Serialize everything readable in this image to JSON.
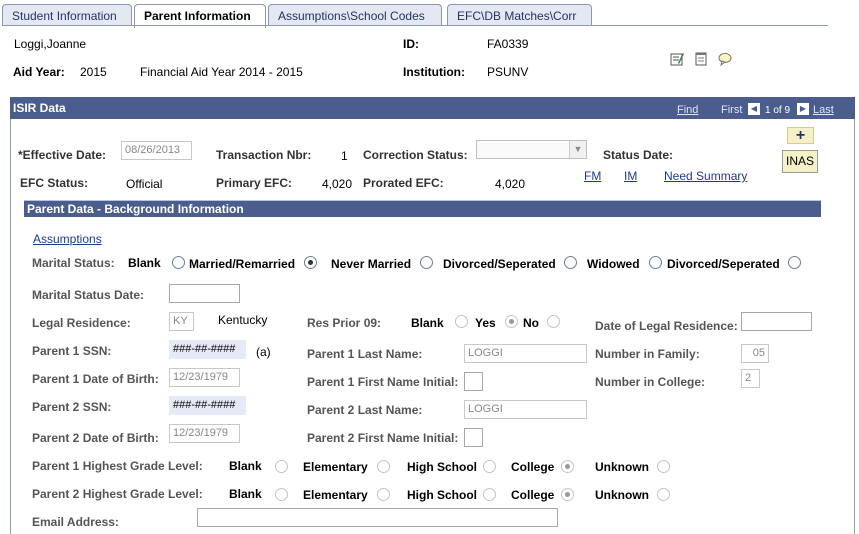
{
  "tabs": [
    {
      "label": "Student Information",
      "active": false
    },
    {
      "label": "Parent Information",
      "active": true
    },
    {
      "label": "Assumptions\\School Codes",
      "active": false
    },
    {
      "label": "EFC\\DB Matches\\Corr",
      "active": false
    }
  ],
  "header": {
    "name": "Loggi,Joanne",
    "id_label": "ID:",
    "id_value": "FA0339",
    "aid_year_label": "Aid Year:",
    "aid_year_value": "2015",
    "aid_year_desc": "Financial Aid Year 2014 - 2015",
    "institution_label": "Institution:",
    "institution_value": "PSUNV"
  },
  "toolbar_icons": [
    "edit-notes-icon",
    "notepad-icon",
    "comment-icon"
  ],
  "isir": {
    "title": "ISIR Data",
    "find": "Find",
    "first": "First",
    "counter": "1 of 9",
    "last": "Last",
    "effective_date_label": "*Effective Date:",
    "effective_date_value": "08/26/2013",
    "transaction_label": "Transaction Nbr:",
    "transaction_value": "1",
    "correction_label": "Correction Status:",
    "correction_value": "",
    "status_date_label": "Status Date:",
    "efc_status_label": "EFC Status:",
    "efc_status_value": "Official",
    "primary_efc_label": "Primary EFC:",
    "primary_efc_value": "4,020",
    "prorated_efc_label": "Prorated EFC:",
    "prorated_efc_value": "4,020",
    "fm_link": "FM",
    "im_link": "IM",
    "need_summary_link": "Need Summary",
    "plus_label": "+",
    "inas_label": "INAS"
  },
  "parent": {
    "section_title": "Parent Data - Background Information",
    "assumptions_link": "Assumptions",
    "marital_status_label": "Marital Status:",
    "marital_options": [
      "Blank",
      "Married/Remarried",
      "Never Married",
      "Divorced/Seperated",
      "Widowed",
      "Divorced/Seperated"
    ],
    "marital_status_date_label": "Marital Status Date:",
    "marital_status_date_value": "",
    "legal_residence_label": "Legal Residence:",
    "legal_residence_code": "KY",
    "legal_residence_name": "Kentucky",
    "res_prior_label": "Res Prior 09:",
    "res_prior_options": [
      "Blank",
      "Yes",
      "No"
    ],
    "date_legal_residence_label": "Date of Legal Residence:",
    "date_legal_residence_value": "",
    "p1_ssn_label": "Parent 1 SSN:",
    "p1_ssn_value": "###-##-####",
    "p1_ssn_suffix": "(a)",
    "p1_last_label": "Parent 1 Last Name:",
    "p1_last_value": "LOGGI",
    "num_family_label": "Number in Family:",
    "num_family_value": "05",
    "p1_dob_label": "Parent 1 Date of Birth:",
    "p1_dob_value": "12/23/1979",
    "p1_first_label": "Parent 1 First Name Initial:",
    "p1_first_value": "",
    "num_college_label": "Number in College:",
    "num_college_value": "2",
    "p2_ssn_label": "Parent 2 SSN:",
    "p2_ssn_value": "###-##-####",
    "p2_last_label": "Parent 2 Last Name:",
    "p2_last_value": "LOGGI",
    "p2_dob_label": "Parent 2 Date of Birth:",
    "p2_dob_value": "12/23/1979",
    "p2_first_label": "Parent 2 First Name Initial:",
    "p2_first_value": "",
    "p1_grade_label": "Parent 1 Highest Grade Level:",
    "p2_grade_label": "Parent 2 Highest Grade Level:",
    "grade_options": [
      "Blank",
      "Elementary",
      "High School",
      "College",
      "Unknown"
    ],
    "email_label": "Email Address:",
    "email_value": ""
  },
  "colors": {
    "bar": "#4a5d8c",
    "link": "#1f3a93",
    "button_bg": "#f6f0c8"
  }
}
